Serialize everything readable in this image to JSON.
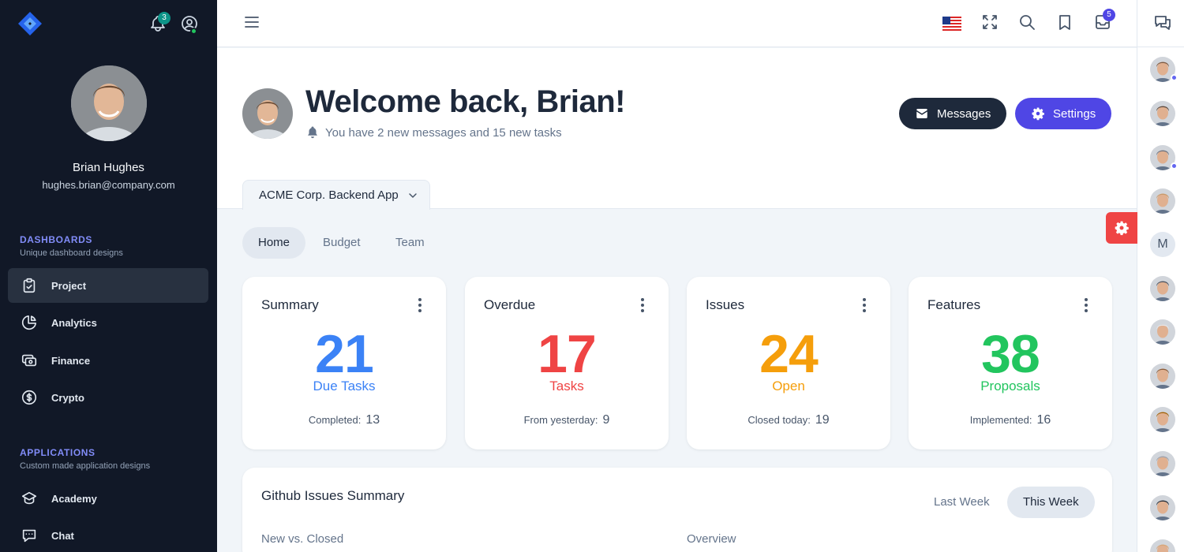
{
  "sidebar": {
    "notification_count": "3",
    "user": {
      "name": "Brian Hughes",
      "email": "hughes.brian@company.com"
    },
    "groups": [
      {
        "title": "DASHBOARDS",
        "subtitle": "Unique dashboard designs",
        "items": [
          {
            "label": "Project",
            "icon": "clipboard-check-icon",
            "active": true
          },
          {
            "label": "Analytics",
            "icon": "chart-pie-icon"
          },
          {
            "label": "Finance",
            "icon": "cash-icon"
          },
          {
            "label": "Crypto",
            "icon": "currency-dollar-icon"
          }
        ]
      },
      {
        "title": "APPLICATIONS",
        "subtitle": "Custom made application designs",
        "items": [
          {
            "label": "Academy",
            "icon": "academic-cap-icon"
          },
          {
            "label": "Chat",
            "icon": "chat-alt-icon"
          }
        ]
      }
    ]
  },
  "topbar": {
    "mail_count": "5",
    "language_flag": "us-flag-icon"
  },
  "header": {
    "title": "Welcome back, Brian!",
    "subtitle": "You have 2 new messages and 15 new tasks",
    "messages_label": "Messages",
    "settings_label": "Settings",
    "project_selector": "ACME Corp. Backend App"
  },
  "tabs": [
    "Home",
    "Budget",
    "Team"
  ],
  "cards": [
    {
      "title": "Summary",
      "value": "21",
      "label": "Due Tasks",
      "foot_label": "Completed:",
      "foot_value": "13",
      "color": "#3b82f6"
    },
    {
      "title": "Overdue",
      "value": "17",
      "label": "Tasks",
      "foot_label": "From yesterday:",
      "foot_value": "9",
      "color": "#ef4444"
    },
    {
      "title": "Issues",
      "value": "24",
      "label": "Open",
      "foot_label": "Closed today:",
      "foot_value": "19",
      "color": "#f59e0b"
    },
    {
      "title": "Features",
      "value": "38",
      "label": "Proposals",
      "foot_label": "Implemented:",
      "foot_value": "16",
      "color": "#22c55e"
    }
  ],
  "github": {
    "title": "Github Issues Summary",
    "last_week": "Last Week",
    "this_week": "This Week",
    "left_sub": "New vs. Closed",
    "right_sub": "Overview"
  },
  "rail": {
    "letter_avatar": "M"
  },
  "colors": {
    "sidebar_bg": "#111827",
    "accent": "#4f46e5",
    "danger": "#ef4444"
  }
}
